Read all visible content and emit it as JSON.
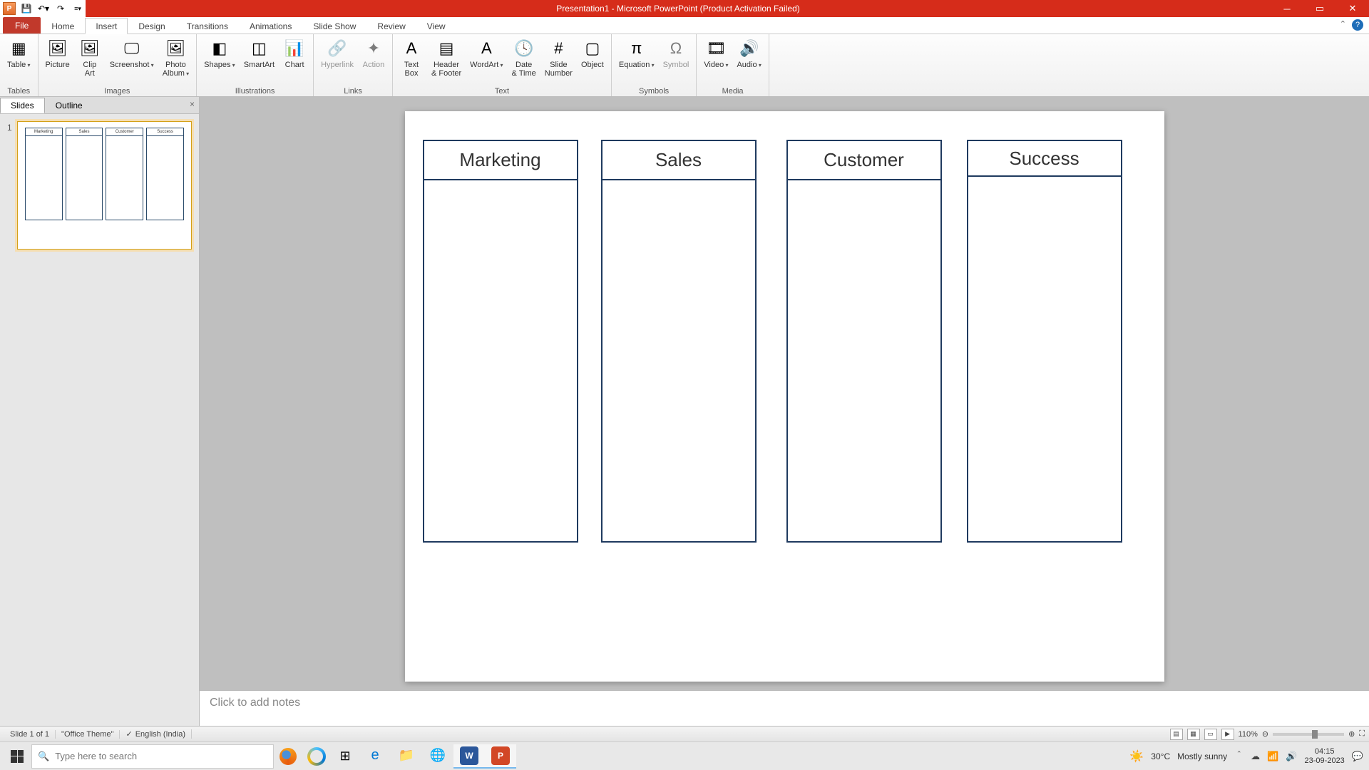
{
  "title": "Presentation1 - Microsoft PowerPoint (Product Activation Failed)",
  "qat": {
    "logo": "P"
  },
  "tabs": {
    "file": "File",
    "list": [
      "Home",
      "Insert",
      "Design",
      "Transitions",
      "Animations",
      "Slide Show",
      "Review",
      "View"
    ],
    "active": "Insert"
  },
  "ribbon": {
    "groups": [
      {
        "label": "Tables",
        "items": [
          {
            "label": "Table",
            "drop": true,
            "icon": "▦"
          }
        ]
      },
      {
        "label": "Images",
        "items": [
          {
            "label": "Picture",
            "icon": "🖼"
          },
          {
            "label": "Clip\nArt",
            "icon": "🖼"
          },
          {
            "label": "Screenshot",
            "drop": true,
            "icon": "🖵"
          },
          {
            "label": "Photo\nAlbum",
            "drop": true,
            "icon": "🖼"
          }
        ]
      },
      {
        "label": "Illustrations",
        "items": [
          {
            "label": "Shapes",
            "drop": true,
            "icon": "◧"
          },
          {
            "label": "SmartArt",
            "icon": "◫"
          },
          {
            "label": "Chart",
            "icon": "📊"
          }
        ]
      },
      {
        "label": "Links",
        "items": [
          {
            "label": "Hyperlink",
            "icon": "🔗",
            "disabled": true
          },
          {
            "label": "Action",
            "icon": "✦",
            "disabled": true
          }
        ]
      },
      {
        "label": "Text",
        "items": [
          {
            "label": "Text\nBox",
            "icon": "A"
          },
          {
            "label": "Header\n& Footer",
            "icon": "▤"
          },
          {
            "label": "WordArt",
            "drop": true,
            "icon": "A"
          },
          {
            "label": "Date\n& Time",
            "icon": "🕓"
          },
          {
            "label": "Slide\nNumber",
            "icon": "#"
          },
          {
            "label": "Object",
            "icon": "▢"
          }
        ]
      },
      {
        "label": "Symbols",
        "items": [
          {
            "label": "Equation",
            "drop": true,
            "icon": "π"
          },
          {
            "label": "Symbol",
            "icon": "Ω",
            "disabled": true
          }
        ]
      },
      {
        "label": "Media",
        "items": [
          {
            "label": "Video",
            "drop": true,
            "icon": "🎞"
          },
          {
            "label": "Audio",
            "drop": true,
            "icon": "🔊"
          }
        ]
      }
    ]
  },
  "pane": {
    "slides": "Slides",
    "outline": "Outline",
    "close": "×",
    "thumbNum": "1"
  },
  "slide": {
    "cols": [
      "Marketing",
      "Sales",
      "Customer",
      "Success"
    ]
  },
  "notes": "Click to add notes",
  "status": {
    "slide": "Slide 1 of 1",
    "theme": "\"Office Theme\"",
    "lang": "English (India)",
    "zoom": "110%"
  },
  "taskbar": {
    "search": "Type here to search",
    "weather_temp": "30°C",
    "weather_text": "Mostly sunny",
    "time": "04:15",
    "date": "23-09-2023"
  }
}
